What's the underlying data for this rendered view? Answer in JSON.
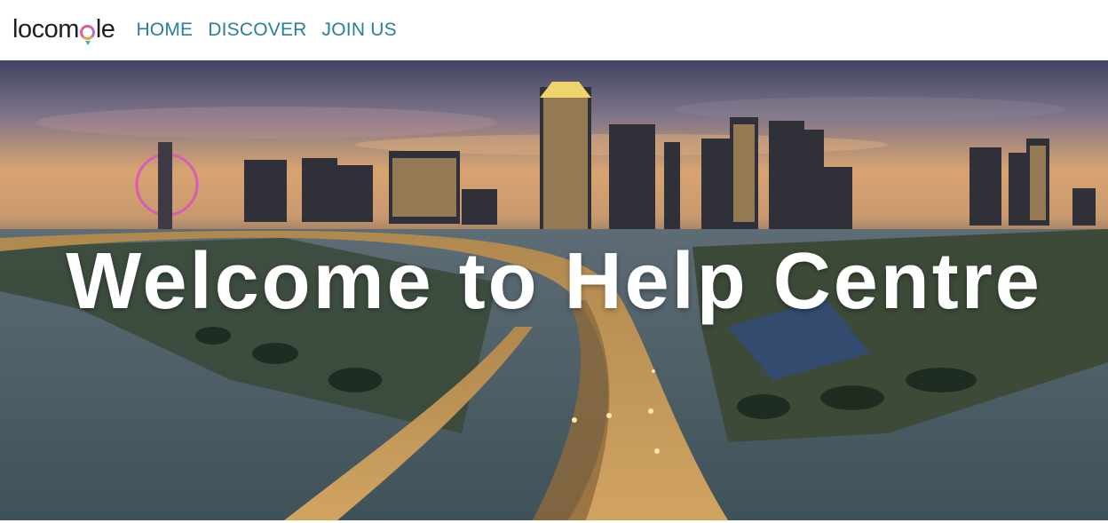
{
  "brand": {
    "name_prefix": "locom",
    "name_suffix": "le",
    "accent_colors": [
      "#e05a9e",
      "#b46be0",
      "#e8a33d",
      "#3fb6b0"
    ]
  },
  "nav": {
    "items": [
      {
        "label": "HOME"
      },
      {
        "label": "DISCOVER"
      },
      {
        "label": "JOIN US"
      }
    ],
    "link_color": "#2a7f9a"
  },
  "hero": {
    "title": "Welcome to Help Centre",
    "image_subject": "city skyline at dusk with highway"
  }
}
